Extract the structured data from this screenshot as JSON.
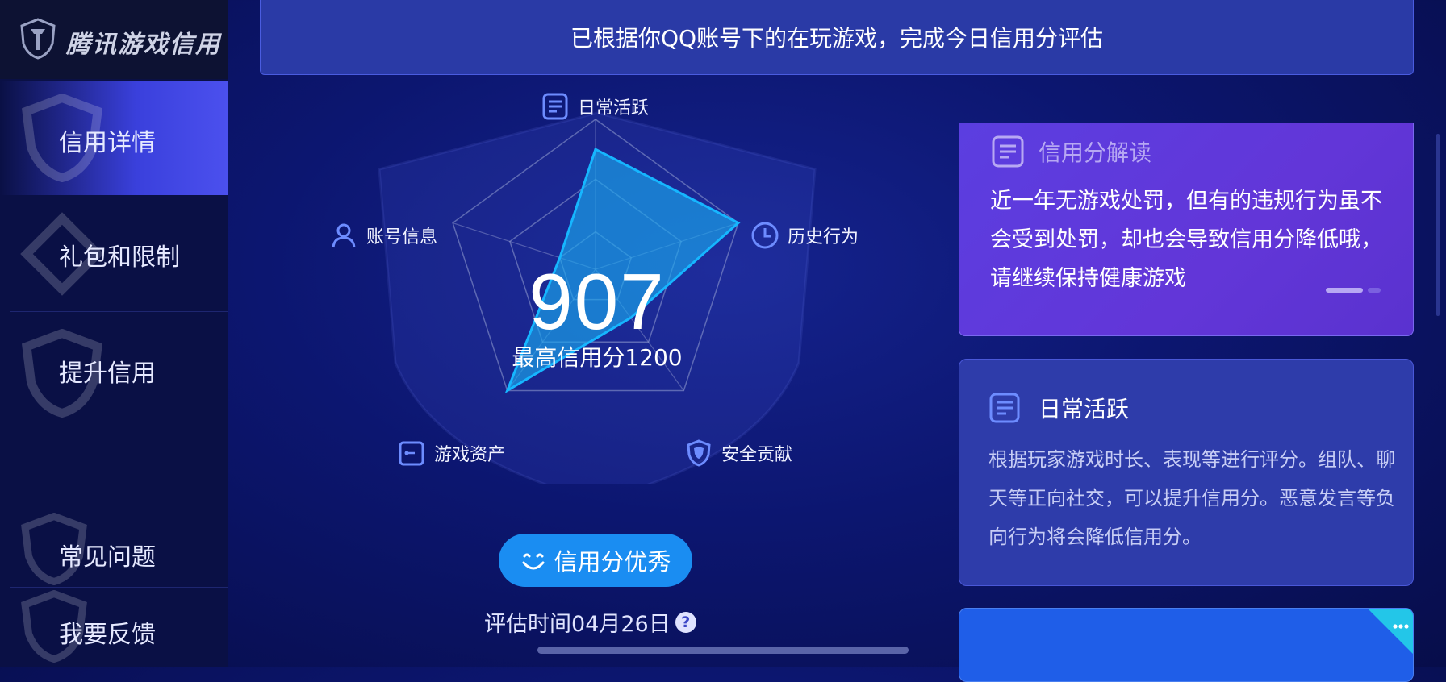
{
  "app": {
    "logo_text": "腾讯游戏信用"
  },
  "sidebar": {
    "items": [
      {
        "label": "信用详情"
      },
      {
        "label": "礼包和限制"
      },
      {
        "label": "提升信用"
      },
      {
        "label": "常见问题"
      },
      {
        "label": "我要反馈"
      }
    ]
  },
  "banner": {
    "text": "已根据你QQ账号下的在玩游戏，完成今日信用分评估"
  },
  "radar": {
    "score": "907",
    "max_text": "最高信用分1200",
    "axes": [
      {
        "label": "日常活跃",
        "icon": "document-icon",
        "value": 0.8
      },
      {
        "label": "历史行为",
        "icon": "clock-icon",
        "value": 1.0
      },
      {
        "label": "安全贡献",
        "icon": "shield-icon",
        "value": 0.4
      },
      {
        "label": "游戏资产",
        "icon": "wallet-icon",
        "value": 1.0
      },
      {
        "label": "账号信息",
        "icon": "user-icon",
        "value": 0.25
      }
    ]
  },
  "badge": {
    "label": "信用分优秀"
  },
  "eval": {
    "time_text": "评估时间04月26日",
    "help": "?"
  },
  "interpretation": {
    "title": "信用分解读",
    "body": "近一年无游戏处罚，但有的违规行为虽不会受到处罚，却也会导致信用分降低哦，请继续保持健康游戏"
  },
  "daily_card": {
    "title": "日常活跃",
    "body": "根据玩家游戏时长、表现等进行评分。组队、聊天等正向社交，可以提升信用分。恶意发言等负向行为将会降低信用分。"
  },
  "colors": {
    "accent": "#1a8df2",
    "radar_fill": "#1aa7ee",
    "card_purple": "#5b3ee0"
  }
}
